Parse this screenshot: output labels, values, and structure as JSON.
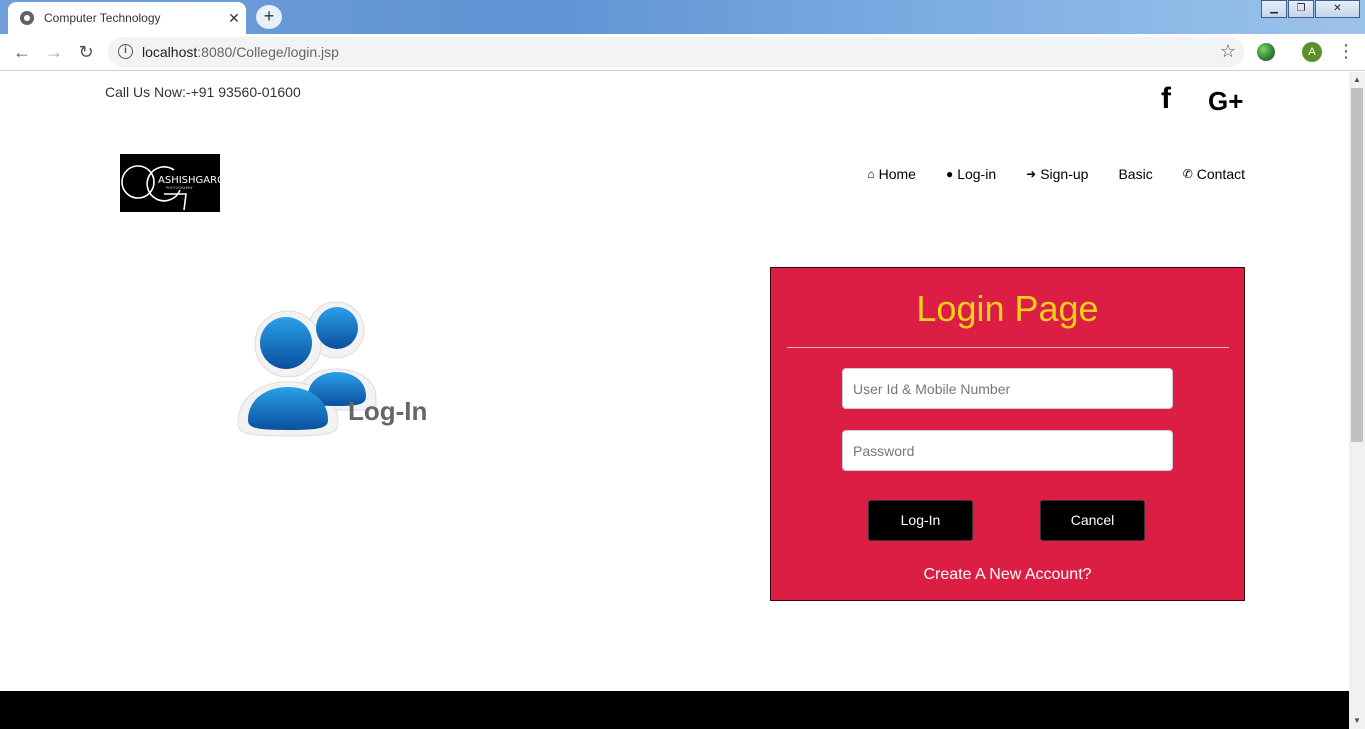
{
  "browser": {
    "tab_title": "Computer Technology",
    "tab_close": "✕",
    "new_tab": "+",
    "url_host": "localhost",
    "url_rest": ":8080/College/login.jsp",
    "profile_initial": "A",
    "window_min": "▁",
    "window_max": "❐",
    "window_close": "✕"
  },
  "header": {
    "call_text": "Call Us Now:-+91 93560-01600",
    "facebook_glyph": "f",
    "googleplus_glyph": "G+",
    "logo_text": "ASHISHGARG",
    "logo_subtext": "PHOTOGRAPHY"
  },
  "nav": {
    "items": [
      {
        "icon": "home-icon",
        "glyph": "⌂",
        "label": "Home"
      },
      {
        "icon": "user-icon",
        "glyph": "●",
        "label": "Log-in"
      },
      {
        "icon": "sign-in-icon",
        "glyph": "➜",
        "label": "Sign-up"
      },
      {
        "icon": "",
        "glyph": "",
        "label": "Basic"
      },
      {
        "icon": "phone-icon",
        "glyph": "✆",
        "label": "Contact"
      }
    ]
  },
  "illustration": {
    "caption": "Log-In"
  },
  "login_panel": {
    "title": "Login Page",
    "user_placeholder": "User Id & Mobile Number",
    "password_placeholder": "Password",
    "login_button": "Log-In",
    "cancel_button": "Cancel",
    "create_account": "Create A New Account?"
  },
  "colors": {
    "panel_bg": "#dc1e44",
    "panel_title": "#f3d01a",
    "button_bg": "#000000",
    "footer_bg": "#000000"
  }
}
